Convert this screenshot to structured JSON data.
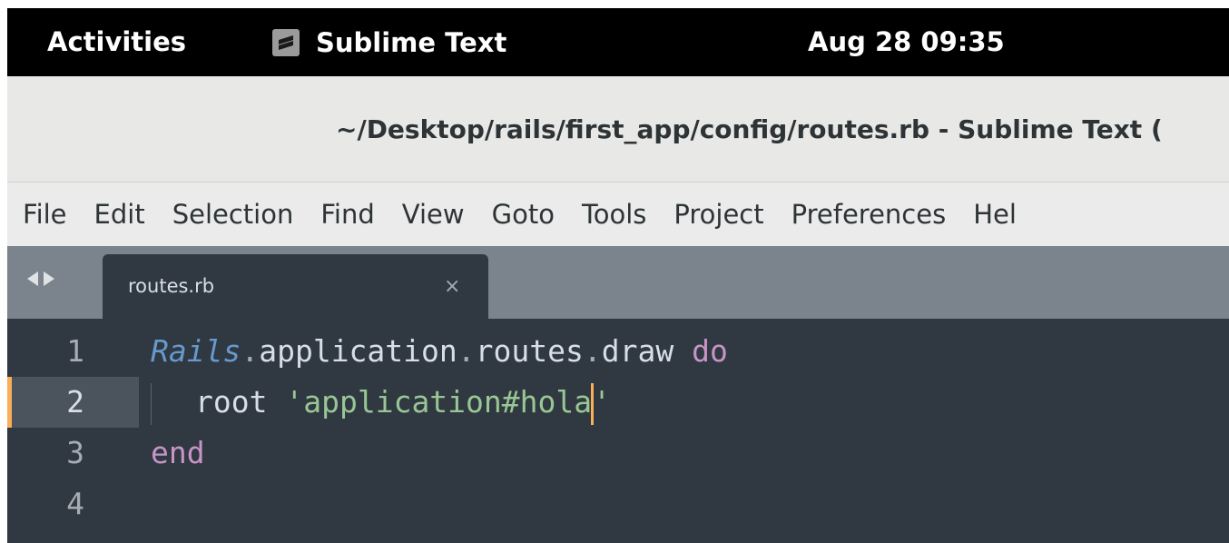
{
  "topbar": {
    "activities_label": "Activities",
    "app_name": "Sublime Text",
    "app_icon": "sublime-text-icon",
    "clock": "Aug 28  09:35"
  },
  "window": {
    "title": "~/Desktop/rails/first_app/config/routes.rb - Sublime Text ("
  },
  "menubar": {
    "items": [
      "File",
      "Edit",
      "Selection",
      "Find",
      "View",
      "Goto",
      "Tools",
      "Project",
      "Preferences",
      "Hel"
    ]
  },
  "tabs": {
    "nav_left_icon": "arrow-left-icon",
    "nav_right_icon": "arrow-right-icon",
    "active": {
      "label": "routes.rb",
      "close_glyph": "×"
    }
  },
  "editor": {
    "current_line": 2,
    "lines": [
      {
        "number": "1",
        "tokens": [
          {
            "text": "Rails",
            "type": "class"
          },
          {
            "text": ".",
            "type": "punct"
          },
          {
            "text": "application",
            "type": "plain"
          },
          {
            "text": ".",
            "type": "punct"
          },
          {
            "text": "routes",
            "type": "plain"
          },
          {
            "text": ".",
            "type": "punct"
          },
          {
            "text": "draw",
            "type": "plain"
          },
          {
            "text": " ",
            "type": "plain"
          },
          {
            "text": "do",
            "type": "keyword"
          }
        ]
      },
      {
        "number": "2",
        "tokens": [
          {
            "text": "root",
            "type": "plain"
          },
          {
            "text": " ",
            "type": "plain"
          },
          {
            "text": "'",
            "type": "quote"
          },
          {
            "text": "application#hola",
            "type": "string"
          },
          {
            "text": "'",
            "type": "quote"
          }
        ]
      },
      {
        "number": "3",
        "tokens": [
          {
            "text": "end",
            "type": "keyword"
          }
        ]
      },
      {
        "number": "4",
        "tokens": []
      }
    ]
  },
  "colors": {
    "editor_bg": "#303841",
    "tab_bar_bg": "#7b838c",
    "caret": "#f9ae58",
    "keyword": "#c695c6",
    "string": "#99c794",
    "class": "#6699cc"
  }
}
